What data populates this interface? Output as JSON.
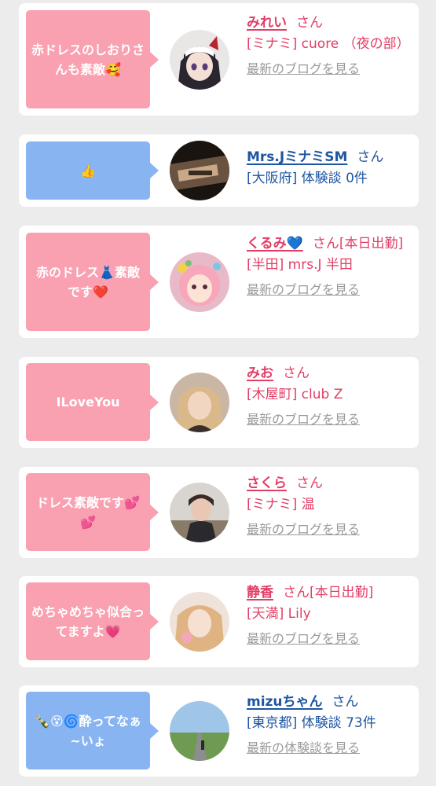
{
  "cards": [
    {
      "bubble": "赤ドレスのしおりさんも素敵🥰",
      "name": "みれい",
      "suffix": "さん",
      "shop": "[ミナミ] cuore （夜の部）",
      "link": "最新のブログを見る",
      "theme": "pink"
    },
    {
      "bubble": "👍",
      "name": "Mrs.JミナミSM",
      "suffix": "さん",
      "shop": "[大阪府] 体験談 0件",
      "link": "",
      "theme": "blue"
    },
    {
      "bubble": "赤のドレス👗素敵です❤️",
      "name": "くるみ💙",
      "suffix": "さん[本日出勤]",
      "shop": "[半田] mrs.J 半田",
      "link": "最新のブログを見る",
      "theme": "pink"
    },
    {
      "bubble": "ILoveYou",
      "name": "みお",
      "suffix": "さん",
      "shop": "[木屋町] club Z",
      "link": "最新のブログを見る",
      "theme": "pink"
    },
    {
      "bubble": "ドレス素敵です💕💕",
      "name": "さくら",
      "suffix": "さん",
      "shop": "[ミナミ] 温",
      "link": "最新のブログを見る",
      "theme": "pink"
    },
    {
      "bubble": "めちゃめちゃ似合ってますよ💗",
      "name": "静香",
      "suffix": "さん[本日出勤]",
      "shop": "[天満] Lily",
      "link": "最新のブログを見る",
      "theme": "pink"
    },
    {
      "bubble": "🍾😵🌀酔ってなぁ~いょ",
      "name": "mizuちゃん",
      "suffix": "さん",
      "shop": "[東京都] 体験談 73件",
      "link": "最新の体験談を見る",
      "theme": "blue"
    }
  ],
  "colors": {
    "pink_bubble": "#f9a0b1",
    "blue_bubble": "#88b4f2",
    "pink_text": "#e23d65",
    "blue_text": "#1e56a3",
    "link_gray": "#9a9a9a",
    "page_bg": "#ececec"
  }
}
